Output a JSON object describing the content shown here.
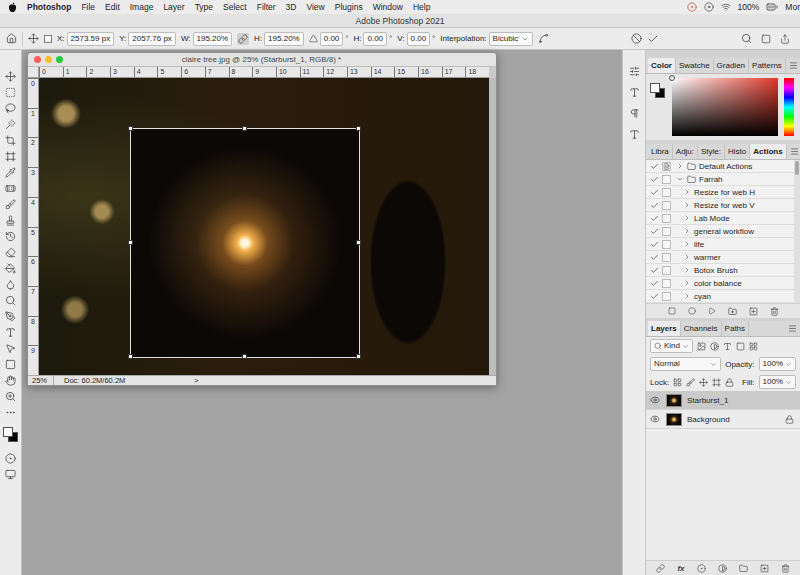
{
  "menu_bar": {
    "app": "Photoshop",
    "items": [
      "File",
      "Edit",
      "Image",
      "Layer",
      "Type",
      "Select",
      "Filter",
      "3D",
      "View",
      "Plugins",
      "Window",
      "Help"
    ],
    "battery": "100%",
    "user": "Mor"
  },
  "app_title": "Adobe Photoshop 2021",
  "options_bar": {
    "reference_point_checked": false,
    "fields": [
      {
        "kind": "field",
        "label": "X:",
        "value": "2573.59 px"
      },
      {
        "kind": "field",
        "label": "Y:",
        "value": "2057.76 px"
      },
      {
        "kind": "field",
        "label": "W:",
        "value": "195.20%"
      },
      {
        "kind": "link",
        "selected": true
      },
      {
        "kind": "field",
        "label": "H:",
        "value": "195.20%"
      },
      {
        "kind": "angle",
        "value": "0.00",
        "unit": "°"
      },
      {
        "kind": "field",
        "label": "H:",
        "value": "0.00",
        "unit": "°"
      },
      {
        "kind": "field",
        "label": "V:",
        "value": "0.00",
        "unit": "°"
      }
    ],
    "interpolation": {
      "label": "Interpolation:",
      "value": "Bicubic"
    }
  },
  "colors": {
    "foreground": "#ffffff",
    "background": "#000000"
  },
  "document": {
    "title": "claire tree.jpg @ 25% (Starburst_1, RGB/8) *",
    "h_ruler": [
      "0",
      "1",
      "2",
      "3",
      "4",
      "5",
      "6",
      "7",
      "8",
      "9",
      "10",
      "11",
      "12",
      "13",
      "14",
      "15",
      "16",
      "17",
      "18"
    ],
    "v_ruler": [
      "0",
      "1",
      "2",
      "3",
      "4",
      "5",
      "6",
      "7",
      "8",
      "9"
    ],
    "zoom": "25%",
    "doc_size": "Doc: 60.2M/60.2M",
    "arrow": ">"
  },
  "color_panel": {
    "tabs": [
      {
        "label": "Color",
        "selected": true
      },
      {
        "label": "Swatche",
        "selected": false
      },
      {
        "label": "Gradien",
        "selected": false
      },
      {
        "label": "Patterns",
        "selected": false
      }
    ]
  },
  "actions_panel": {
    "tabs": [
      {
        "label": "Libra",
        "selected": false
      },
      {
        "label": "Adju:",
        "selected": false
      },
      {
        "label": "Style:",
        "selected": false
      },
      {
        "label": "Histo",
        "selected": false
      },
      {
        "label": "Actions",
        "selected": true
      }
    ],
    "items": [
      {
        "name": "Default Actions",
        "kind": "set",
        "expanded": false,
        "checked": true,
        "dialog": true
      },
      {
        "name": "Farrah",
        "kind": "set",
        "expanded": true,
        "checked": true,
        "dialog": false
      },
      {
        "name": "Resize for web H",
        "kind": "action",
        "expanded": false,
        "checked": true,
        "dialog": false
      },
      {
        "name": "Resize for web V",
        "kind": "action",
        "expanded": false,
        "checked": true,
        "dialog": false
      },
      {
        "name": "Lab Mode",
        "kind": "action",
        "expanded": false,
        "checked": true,
        "dialog": false
      },
      {
        "name": "general workflow",
        "kind": "action",
        "expanded": false,
        "checked": true,
        "dialog": false
      },
      {
        "name": "life",
        "kind": "action",
        "expanded": false,
        "checked": true,
        "dialog": false
      },
      {
        "name": "warmer",
        "kind": "action",
        "expanded": false,
        "checked": true,
        "dialog": false
      },
      {
        "name": "Botox Brush",
        "kind": "action",
        "expanded": false,
        "checked": true,
        "dialog": false
      },
      {
        "name": "color balance",
        "kind": "action",
        "expanded": false,
        "checked": true,
        "dialog": false
      },
      {
        "name": "cyan",
        "kind": "action",
        "expanded": false,
        "checked": true,
        "dialog": false
      }
    ]
  },
  "layers_panel": {
    "tabs": [
      {
        "label": "Layers",
        "selected": true
      },
      {
        "label": "Channels",
        "selected": false
      },
      {
        "label": "Paths",
        "selected": false
      }
    ],
    "filter": "Kind",
    "blend_mode": "Normal",
    "opacity": {
      "label": "Opacity:",
      "value": "100%"
    },
    "lock_label": "Lock:",
    "fill": {
      "label": "Fill:",
      "value": "100%"
    },
    "layers": [
      {
        "name": "Starburst_1",
        "visible": true,
        "selected": true,
        "locked": false
      },
      {
        "name": "Background",
        "visible": true,
        "selected": false,
        "locked": true
      }
    ],
    "fx_label": "fx"
  }
}
